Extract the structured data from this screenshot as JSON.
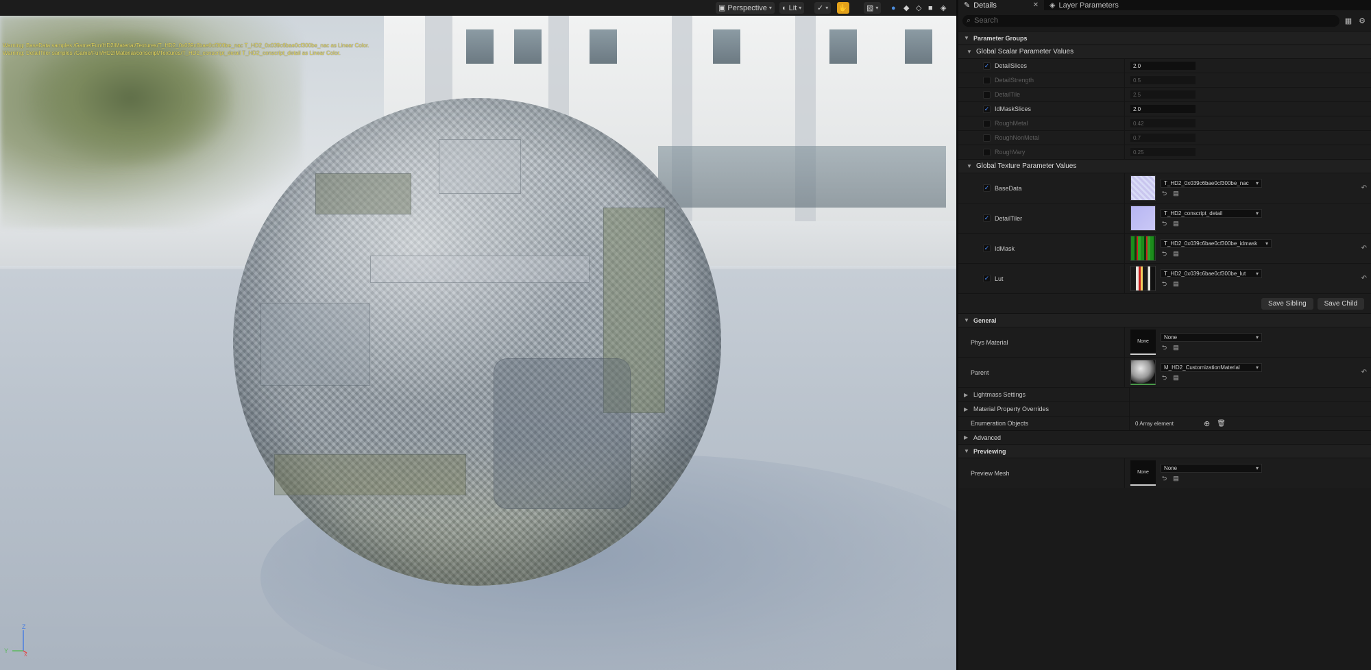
{
  "viewport": {
    "toolbar": {
      "perspective_label": "Perspective",
      "lit_label": "Lit"
    },
    "warnings": [
      "Warning: BaseData samples /Game/Fun/HD2/Material/Textures/T_HD2_0x039c6bae0cf300be_nac T_HD2_0x039c6bae0cf300be_nac as Linear Color.",
      "Warning: DetailTiler samples /Game/Fun/HD2/Material/conscript/Textures/T_HD2_conscript_detail T_HD2_conscript_detail as Linear Color."
    ],
    "axis": {
      "z": "Z",
      "y": "Y",
      "x": "X"
    }
  },
  "panel": {
    "tabs": {
      "details": "Details",
      "layer_parameters": "Layer Parameters"
    },
    "search_placeholder": "Search",
    "parameter_groups_label": "Parameter Groups",
    "scalar": {
      "title": "Global Scalar Parameter Values",
      "rows": [
        {
          "name": "DetailSlices",
          "value": "2.0",
          "enabled": true
        },
        {
          "name": "DetailStrength",
          "value": "0.5",
          "enabled": false
        },
        {
          "name": "DetailTile",
          "value": "2.5",
          "enabled": false
        },
        {
          "name": "IdMaskSlices",
          "value": "2.0",
          "enabled": true
        },
        {
          "name": "RoughMetal",
          "value": "0.42",
          "enabled": false
        },
        {
          "name": "RoughNonMetal",
          "value": "0.7",
          "enabled": false
        },
        {
          "name": "RoughVary",
          "value": "0.25",
          "enabled": false
        }
      ]
    },
    "texture": {
      "title": "Global Texture Parameter Values",
      "rows": [
        {
          "name": "BaseData",
          "asset": "T_HD2_0x039c6bae0cf300be_nac",
          "enabled": true
        },
        {
          "name": "DetailTiler",
          "asset": "T_HD2_conscript_detail",
          "enabled": true
        },
        {
          "name": "IdMask",
          "asset": "T_HD2_0x039c6bae0cf300be_idmask",
          "enabled": true
        },
        {
          "name": "Lut",
          "asset": "T_HD2_0x039c6bae0cf300be_lut",
          "enabled": true
        }
      ],
      "save_sibling": "Save Sibling",
      "save_child": "Save Child"
    },
    "general": {
      "title": "General",
      "phys_material_label": "Phys Material",
      "phys_material_value": "None",
      "phys_material_thumb": "None",
      "parent_label": "Parent",
      "parent_value": "M_HD2_CustomizationMaterial",
      "lightmass_label": "Lightmass Settings",
      "overrides_label": "Material Property Overrides",
      "enumeration_label": "Enumeration Objects",
      "enumeration_value": "0 Array element",
      "advanced_label": "Advanced"
    },
    "previewing": {
      "title": "Previewing",
      "preview_mesh_label": "Preview Mesh",
      "preview_mesh_value": "None",
      "preview_mesh_thumb": "None"
    }
  }
}
